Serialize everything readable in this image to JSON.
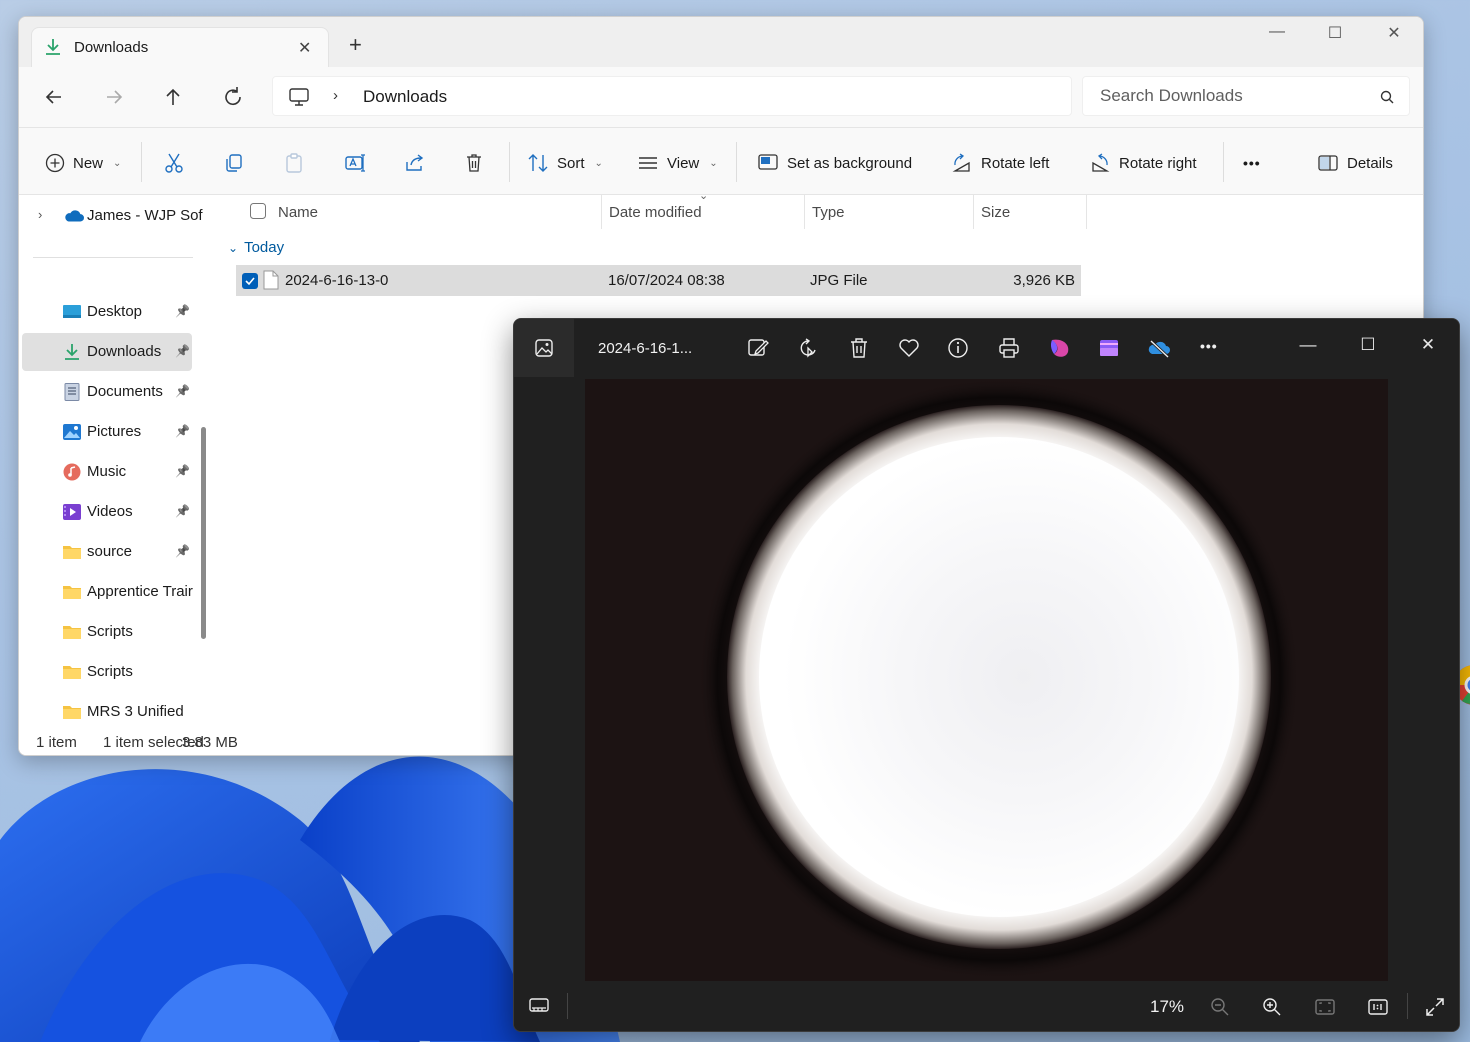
{
  "explorer": {
    "tab": {
      "title": "Downloads",
      "new_tab": "+",
      "close": "✕"
    },
    "window_controls": {
      "minimize": "—",
      "maximize": "☐",
      "close": "✕"
    },
    "address": {
      "crumb": "Downloads",
      "separator": "›"
    },
    "search": {
      "placeholder": "Search Downloads"
    },
    "commands": {
      "new": "New",
      "sort": "Sort",
      "view": "View",
      "set_background": "Set as background",
      "rotate_left": "Rotate left",
      "rotate_right": "Rotate right",
      "more": "•••",
      "details": "Details"
    },
    "sidebar": {
      "onedrive": "James - WJP Sof",
      "items": [
        {
          "label": "Desktop",
          "icon": "desktop-icon",
          "pinned": true
        },
        {
          "label": "Downloads",
          "icon": "downloads-icon",
          "pinned": true,
          "selected": true
        },
        {
          "label": "Documents",
          "icon": "documents-icon",
          "pinned": true
        },
        {
          "label": "Pictures",
          "icon": "pictures-icon",
          "pinned": true
        },
        {
          "label": "Music",
          "icon": "music-icon",
          "pinned": true
        },
        {
          "label": "Videos",
          "icon": "videos-icon",
          "pinned": true
        },
        {
          "label": "source",
          "icon": "folder-icon",
          "pinned": true
        },
        {
          "label": "Apprentice Trair",
          "icon": "folder-icon",
          "pinned": false
        },
        {
          "label": "Scripts",
          "icon": "folder-icon",
          "pinned": false
        },
        {
          "label": "Scripts",
          "icon": "folder-icon",
          "pinned": false
        },
        {
          "label": "MRS 3 Unified",
          "icon": "folder-icon",
          "pinned": false
        }
      ]
    },
    "columns": {
      "name": "Name",
      "date": "Date modified",
      "type": "Type",
      "size": "Size"
    },
    "group": "Today",
    "files": [
      {
        "name": "2024-6-16-13-0",
        "date": "16/07/2024 08:38",
        "type": "JPG File",
        "size": "3,926 KB",
        "selected": true
      }
    ],
    "status": {
      "count": "1 item",
      "selection": "1 item selected",
      "size": "3.83 MB"
    }
  },
  "photos": {
    "title": "2024-6-16-1...",
    "zoom": "17%",
    "window_controls": {
      "minimize": "—",
      "maximize": "☐",
      "close": "✕"
    }
  },
  "colors": {
    "accent": "#005fb8",
    "photos_bg": "#202020",
    "folder": "#f5c342"
  }
}
